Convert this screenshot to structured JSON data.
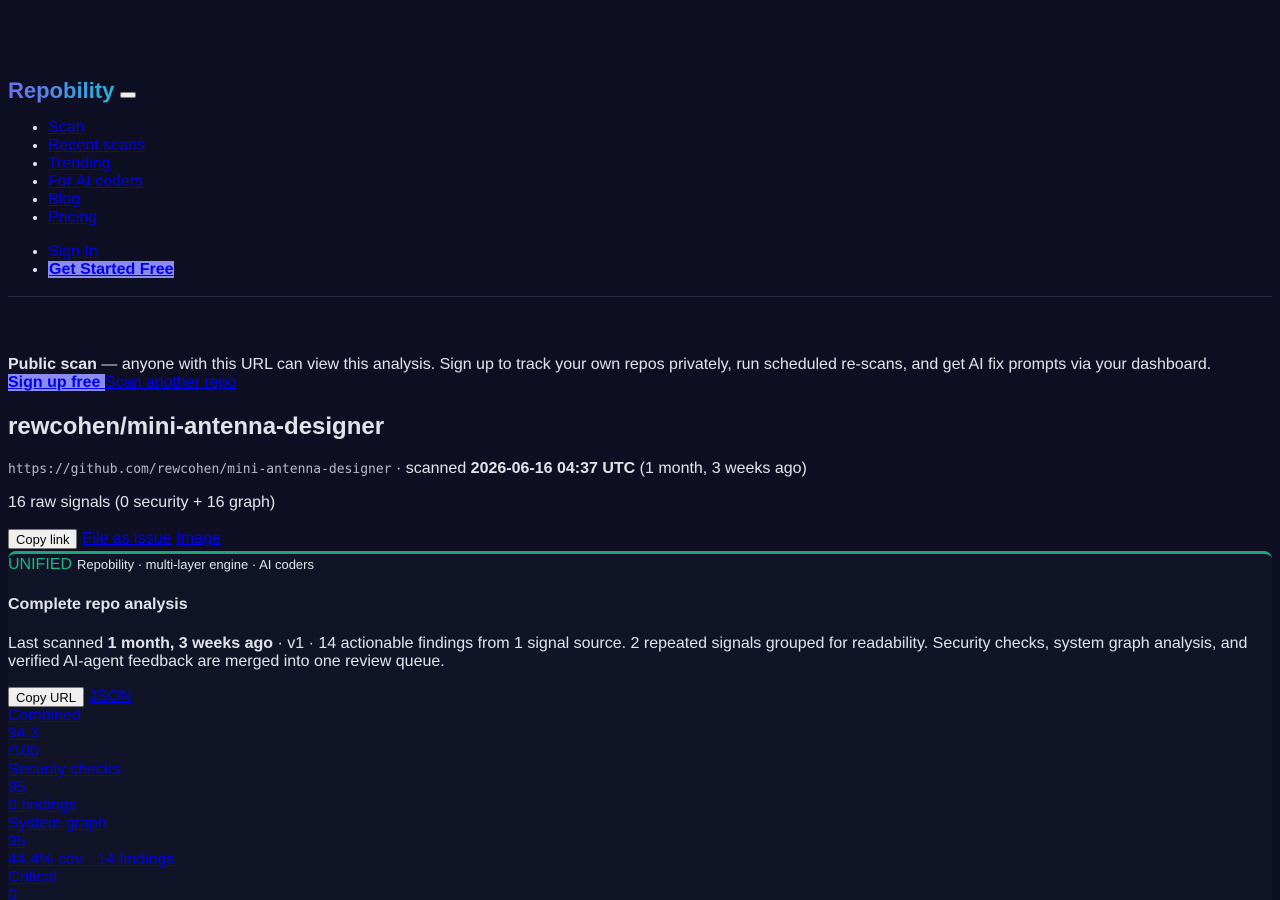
{
  "brand": {
    "name": "Repobility"
  },
  "nav": {
    "main": [
      {
        "label": "Scan"
      },
      {
        "label": "Recent scans"
      },
      {
        "label": "Trending"
      },
      {
        "label": "For AI coders"
      },
      {
        "label": "Blog"
      },
      {
        "label": "Pricing"
      }
    ],
    "sign_in": "Sign In",
    "get_started": "Get Started Free"
  },
  "notice": {
    "lead": "Public scan",
    "text": " — anyone with this URL can view this analysis. Sign up to track your own repos privately, run scheduled re-scans, and get AI fix prompts via your dashboard.",
    "signup_link": "Sign up free ",
    "scan_link": "Scan another repo"
  },
  "repo": {
    "title": "rewcohen/mini-antenna-designer",
    "url": "https://github.com/rewcohen/mini-antenna-designer",
    "scanned_prefix": " · scanned ",
    "scanned_at": "2026-06-16 04:37 UTC",
    "scanned_ago": " (1 month, 3 weeks ago)",
    "raw_signals": "16 raw signals (0 security + 16 graph)"
  },
  "actions": {
    "copy_link": "Copy link",
    "file_issue": "File as issue",
    "image": "Image"
  },
  "card": {
    "badge": "UNIFIED",
    "engine": "Repobility · multi-layer engine · AI coders",
    "title": "Complete repo analysis",
    "desc_prefix": "Last scanned ",
    "desc_ago": "1 month, 3 weeks ago",
    "desc_rest": " · v1 · 14 actionable findings from 1 signal source. 2 repeated signals grouped for readability. Security checks, system graph analysis, and verified AI-agent feedback are merged into one review queue.",
    "copy_url": "Copy URL",
    "json": "JSON",
    "scores": [
      {
        "label": "Combined",
        "value": "94.3",
        "detail": "/100"
      },
      {
        "label": "Security checks",
        "value": "95",
        "detail": "0 findings"
      },
      {
        "label": "System graph",
        "value": "95",
        "detail": "44.4% cov · 14 findings"
      },
      {
        "label": "Critical",
        "value": "0",
        "detail": ""
      }
    ]
  },
  "colors": {
    "background": "#0f0f23",
    "accent_green": "#1fa37a",
    "cta_background": "#8b8bf0"
  }
}
